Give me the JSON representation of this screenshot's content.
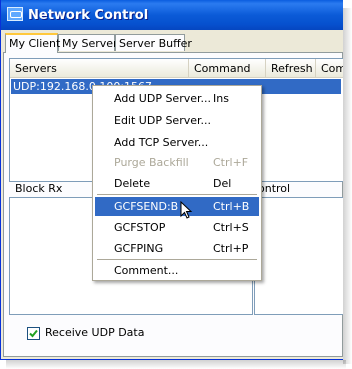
{
  "window": {
    "title": "Network Control"
  },
  "tabs": [
    {
      "label": "My Client",
      "active": true
    },
    {
      "label": "My Server",
      "active": false
    },
    {
      "label": "Server Buffer",
      "active": false
    }
  ],
  "servers_list": {
    "columns": [
      "Servers",
      "Command",
      "Refresh",
      "Comm"
    ],
    "rows": [
      {
        "server": "UDP:192.168.0.100:1567"
      }
    ]
  },
  "sections": {
    "block_rx": "Block Rx",
    "control": "ontrol"
  },
  "receive_udp": {
    "label": "Receive UDP Data",
    "checked": true
  },
  "context_menu": {
    "items": [
      {
        "label": "Add UDP Server...",
        "shortcut": "Ins",
        "enabled": true,
        "highlighted": false
      },
      {
        "label": "Edit UDP Server...",
        "shortcut": "",
        "enabled": true,
        "highlighted": false
      },
      {
        "label": "Add TCP Server...",
        "shortcut": "",
        "enabled": true,
        "highlighted": false
      },
      {
        "label": "Purge Backfill",
        "shortcut": "Ctrl+F",
        "enabled": false,
        "highlighted": false
      },
      {
        "label": "Delete",
        "shortcut": "Del",
        "enabled": true,
        "highlighted": false
      },
      {
        "label": "GCFSEND:B",
        "shortcut": "Ctrl+B",
        "enabled": true,
        "highlighted": true
      },
      {
        "label": "GCFSTOP",
        "shortcut": "Ctrl+S",
        "enabled": true,
        "highlighted": false
      },
      {
        "label": "GCFPING",
        "shortcut": "Ctrl+P",
        "enabled": true,
        "highlighted": false
      },
      {
        "label": "Comment...",
        "shortcut": "",
        "enabled": true,
        "highlighted": false
      }
    ]
  },
  "colors": {
    "titlebar": "#0a5ddf",
    "selection": "#316ac5",
    "window_face": "#ece9d8"
  }
}
